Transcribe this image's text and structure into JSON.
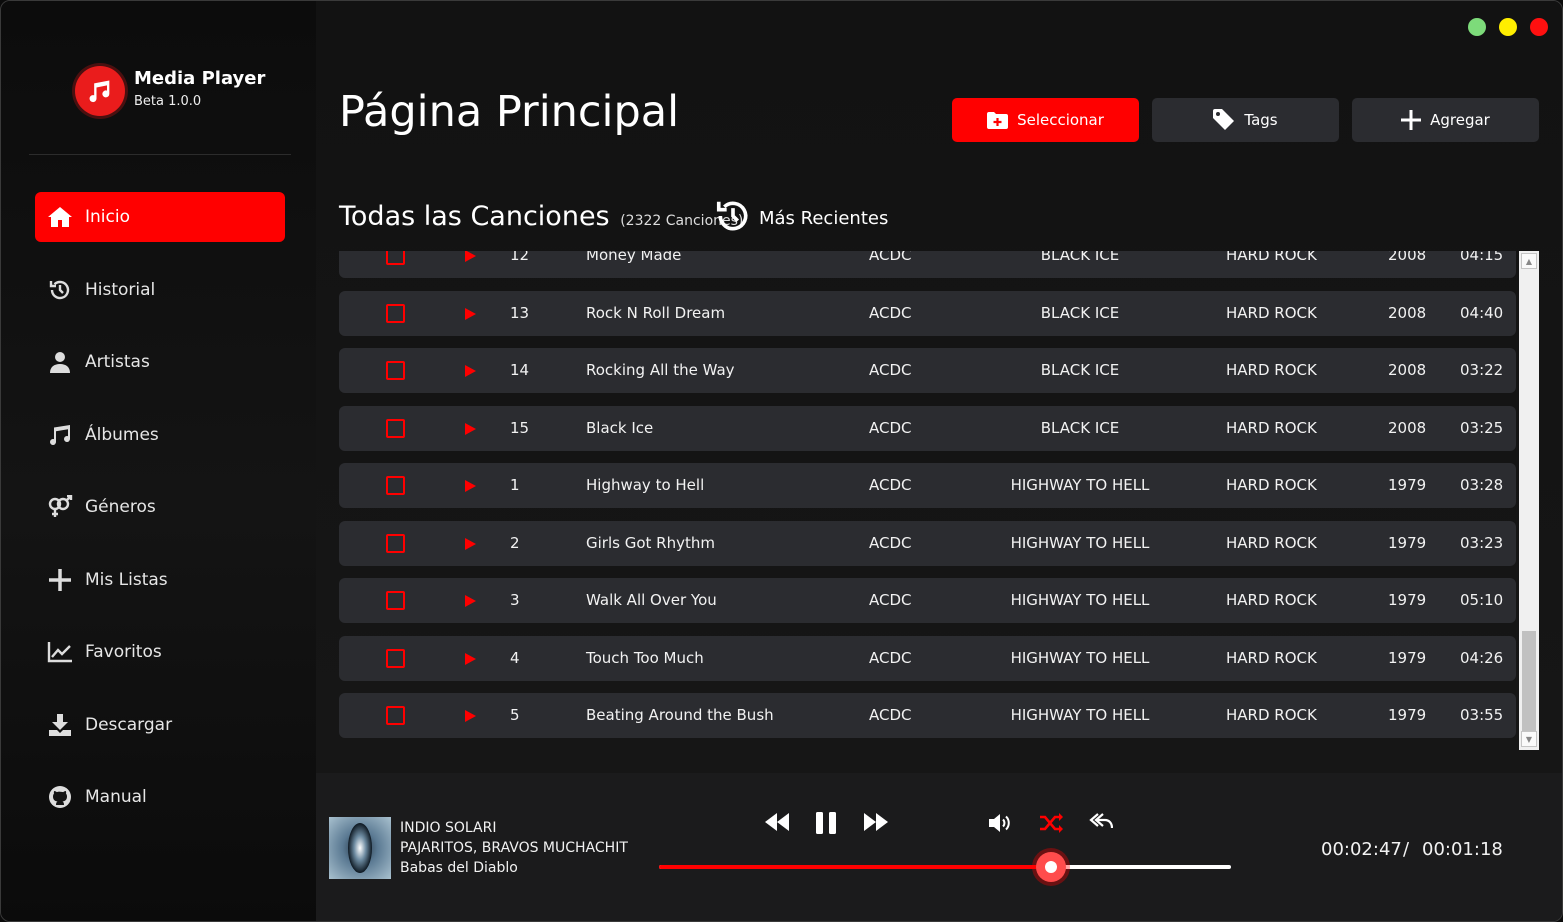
{
  "app": {
    "name": "Media Player",
    "version": "Beta 1.0.0"
  },
  "window_controls": {
    "colors": [
      "#7ddb7a",
      "#ffee00",
      "#ff1010"
    ]
  },
  "sidebar": {
    "items": [
      {
        "label": "Inicio",
        "icon": "home-icon",
        "active": true
      },
      {
        "label": "Historial",
        "icon": "history-icon",
        "active": false
      },
      {
        "label": "Artistas",
        "icon": "user-icon",
        "active": false
      },
      {
        "label": "Álbumes",
        "icon": "music-note-icon",
        "active": false
      },
      {
        "label": "Géneros",
        "icon": "gender-icon",
        "active": false
      },
      {
        "label": "Mis Listas",
        "icon": "plus-icon",
        "active": false
      },
      {
        "label": "Favoritos",
        "icon": "chart-line-icon",
        "active": false
      },
      {
        "label": "Descargar",
        "icon": "download-icon",
        "active": false
      },
      {
        "label": "Manual",
        "icon": "github-icon",
        "active": false
      }
    ]
  },
  "header": {
    "title": "Página Principal",
    "buttons": [
      {
        "label": "Seleccionar",
        "icon": "folder-plus-icon",
        "style": "red"
      },
      {
        "label": "Tags",
        "icon": "tag-icon",
        "style": "dark"
      },
      {
        "label": "Agregar",
        "icon": "plus-icon",
        "style": "dark"
      }
    ]
  },
  "songs_section": {
    "title": "Todas las Canciones",
    "count": "(2322 Canciones)",
    "sort_label": "Más Recientes",
    "rows": [
      {
        "num": "12",
        "title": "Money Made",
        "artist": "ACDC",
        "album": "BLACK ICE",
        "genre": "HARD ROCK",
        "year": "2008",
        "duration": "04:15"
      },
      {
        "num": "13",
        "title": "Rock N Roll Dream",
        "artist": "ACDC",
        "album": "BLACK ICE",
        "genre": "HARD ROCK",
        "year": "2008",
        "duration": "04:40"
      },
      {
        "num": "14",
        "title": "Rocking All the Way",
        "artist": "ACDC",
        "album": "BLACK ICE",
        "genre": "HARD ROCK",
        "year": "2008",
        "duration": "03:22"
      },
      {
        "num": "15",
        "title": "Black Ice",
        "artist": "ACDC",
        "album": "BLACK ICE",
        "genre": "HARD ROCK",
        "year": "2008",
        "duration": "03:25"
      },
      {
        "num": "1",
        "title": "Highway to Hell",
        "artist": "ACDC",
        "album": "HIGHWAY TO HELL",
        "genre": "HARD ROCK",
        "year": "1979",
        "duration": "03:28"
      },
      {
        "num": "2",
        "title": "Girls Got Rhythm",
        "artist": "ACDC",
        "album": "HIGHWAY TO HELL",
        "genre": "HARD ROCK",
        "year": "1979",
        "duration": "03:23"
      },
      {
        "num": "3",
        "title": "Walk All Over You",
        "artist": "ACDC",
        "album": "HIGHWAY TO HELL",
        "genre": "HARD ROCK",
        "year": "1979",
        "duration": "05:10"
      },
      {
        "num": "4",
        "title": "Touch Too Much",
        "artist": "ACDC",
        "album": "HIGHWAY TO HELL",
        "genre": "HARD ROCK",
        "year": "1979",
        "duration": "04:26"
      },
      {
        "num": "5",
        "title": "Beating Around the Bush",
        "artist": "ACDC",
        "album": "HIGHWAY TO HELL",
        "genre": "HARD ROCK",
        "year": "1979",
        "duration": "03:55"
      }
    ]
  },
  "player": {
    "artist": "INDIO SOLARI",
    "album": "PAJARITOS, BRAVOS MUCHACHITOS",
    "track": "Babas del Diablo",
    "elapsed": "00:02:47",
    "separator": "/",
    "remaining": "00:01:18",
    "progress_fraction": 0.686,
    "accent_color": "#ff0000"
  }
}
